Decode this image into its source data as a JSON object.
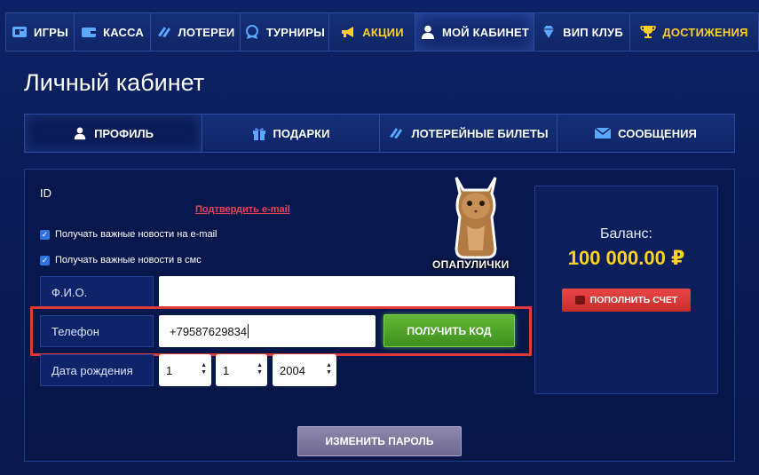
{
  "nav": {
    "items": [
      {
        "label": "ИГРЫ",
        "icon": "gamepad-icon"
      },
      {
        "label": "КАССА",
        "icon": "wallet-icon"
      },
      {
        "label": "ЛОТЕРЕИ",
        "icon": "ticket-icon"
      },
      {
        "label": "ТУРНИРЫ",
        "icon": "trophy-badge-icon"
      },
      {
        "label": "АКЦИИ",
        "icon": "megaphone-icon"
      },
      {
        "label": "МОЙ КАБИНЕТ",
        "icon": "user-icon"
      },
      {
        "label": "ВИП КЛУБ",
        "icon": "diamond-icon"
      },
      {
        "label": "ДОСТИЖЕНИЯ",
        "icon": "cup-icon"
      }
    ],
    "active_index": 5
  },
  "page": {
    "title": "Личный кабинет"
  },
  "tabs": [
    {
      "label": "ПРОФИЛЬ",
      "icon": "user-icon"
    },
    {
      "label": "ПОДАРКИ",
      "icon": "gift-icon"
    },
    {
      "label": "ЛОТЕРЕЙНЫЕ БИЛЕТЫ",
      "icon": "ticket-icon"
    },
    {
      "label": "СООБЩЕНИЯ",
      "icon": "envelope-icon"
    }
  ],
  "profile": {
    "id_label": "ID",
    "confirm_email": "Подтвердить e-mail",
    "checkboxes": [
      {
        "label": "Получать важные новости на e-mail",
        "checked": true
      },
      {
        "label": "Получать важные новости в смс",
        "checked": true
      }
    ],
    "fio_label": "Ф.И.О.",
    "fio_value": "",
    "phone_label": "Телефон",
    "phone_value": "+79587629834",
    "get_code_label": "ПОЛУЧИТЬ КОД",
    "dob_label": "Дата рождения",
    "dob_day": "1",
    "dob_month": "1",
    "dob_year": "2004",
    "change_password_label": "ИЗМЕНИТЬ ПАРОЛЬ",
    "sticker_caption": "ОПАПУЛИЧКИ"
  },
  "balance": {
    "label": "Баланс:",
    "value": "100 000.00 ₽",
    "topup_label": "ПОПОЛНИТЬ СЧЕТ"
  },
  "colors": {
    "accent_yellow": "#ffd21e",
    "green_button": "#4fa329",
    "red_button": "#d63636",
    "highlight_red": "#e03a3a",
    "link_red": "#e4415a"
  }
}
